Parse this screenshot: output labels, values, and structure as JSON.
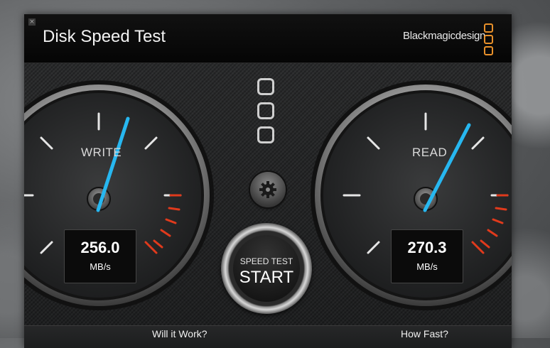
{
  "window": {
    "title": "Disk Speed Test",
    "close_glyph": "×"
  },
  "brand": {
    "name": "Blackmagicdesign",
    "logo_icon": "three-rounded-squares-logo",
    "accent": "#e8902a"
  },
  "status_indicators": {
    "icon": "rounded-square-icon",
    "count": 3
  },
  "write_gauge": {
    "label": "WRITE",
    "value": "256.0",
    "unit": "MB/s",
    "needle_color": "#27b7f0"
  },
  "read_gauge": {
    "label": "READ",
    "value": "270.3",
    "unit": "MB/s",
    "needle_color": "#27b7f0"
  },
  "settings": {
    "icon": "gear-icon"
  },
  "start_button": {
    "small_label": "SPEED TEST",
    "label": "START"
  },
  "footer": {
    "left_label": "Will it Work?",
    "right_label": "How Fast?"
  }
}
